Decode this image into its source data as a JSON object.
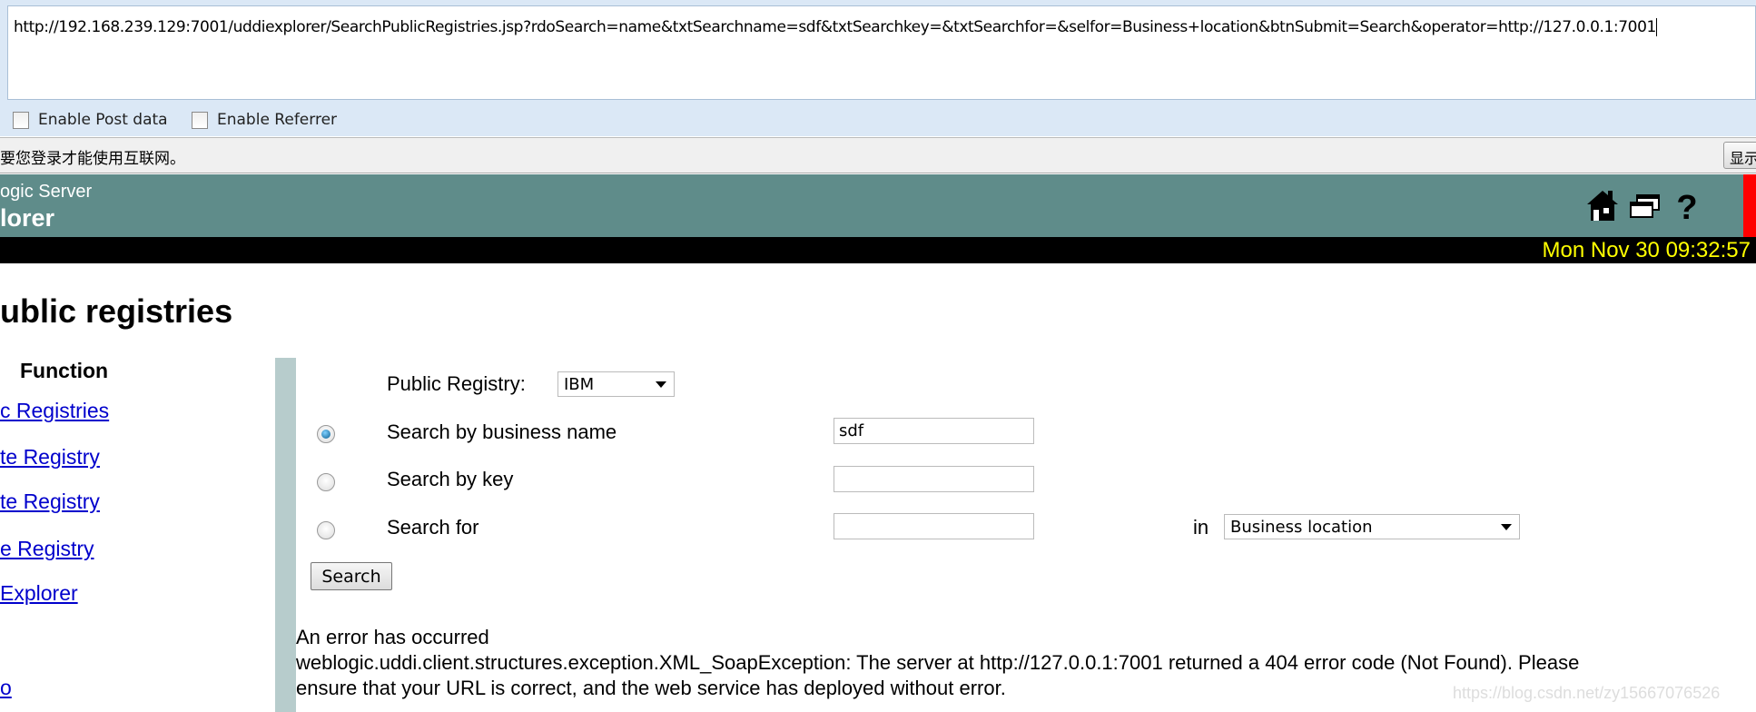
{
  "browser": {
    "url": "http://192.168.239.129:7001/uddiexplorer/SearchPublicRegistries.jsp?rdoSearch=name&txtSearchname=sdf&txtSearchkey=&txtSearchfor=&selfor=Business+location&btnSubmit=Search&operator=http://127.0.0.1:7001",
    "enable_post_data": {
      "label": "Enable Post data",
      "checked": false
    },
    "enable_referrer": {
      "label": "Enable Referrer",
      "checked": false
    },
    "infobar_text": "要您登录才能使用互联网。",
    "infobar_button": "显示"
  },
  "header": {
    "line1": "ogic Server",
    "line2": "lorer",
    "icons": [
      "home-icon",
      "windows-icon",
      "help-icon"
    ],
    "clock": "Mon Nov 30 09:32:57",
    "clock_color": "#ffff00",
    "bg_color": "#5f8c8a"
  },
  "page": {
    "title": "ublic registries"
  },
  "sidebar": {
    "heading": "Function",
    "links": [
      "c Registries",
      "te Registry",
      "te Registry",
      "e Registry",
      "Explorer",
      "o"
    ]
  },
  "form": {
    "public_registry_label": "Public Registry:",
    "public_registry_value": "IBM",
    "rows": [
      {
        "label": "Search by business name",
        "value": "sdf",
        "selected": true
      },
      {
        "label": "Search by key",
        "value": "",
        "selected": false
      },
      {
        "label": "Search for",
        "value": "",
        "selected": false
      }
    ],
    "in_label": "in",
    "selfor_value": "Business location",
    "search_button": "Search"
  },
  "error": {
    "line1": "An error has occurred",
    "line2": "weblogic.uddi.client.structures.exception.XML_SoapException: The server at http://127.0.0.1:7001 returned a 404 error code (Not Found). Please",
    "line3": "ensure that your URL is correct, and the web service has deployed without error."
  },
  "watermark": "https://blog.csdn.net/zy15667076526"
}
